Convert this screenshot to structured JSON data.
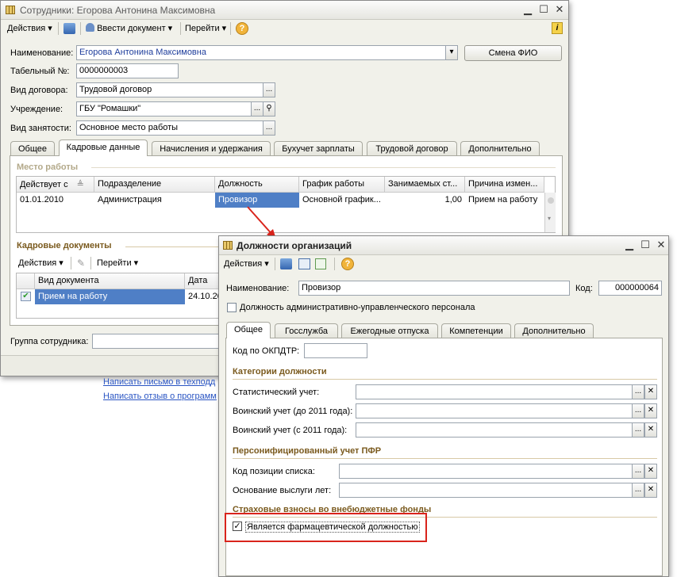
{
  "main_window": {
    "title": "Сотрудники: Егорова Антонина Максимовна",
    "toolbar": {
      "actions": "Действия",
      "enter_document": "Ввести документ",
      "go_to": "Перейти",
      "help_icon": "help-icon"
    },
    "form": {
      "name_label": "Наименование:",
      "name_value": "Егорова Антонина Максимовна",
      "change_name_button": "Смена ФИО",
      "tab_num_label": "Табельный №:",
      "tab_num_value": "0000000003",
      "contract_type_label": "Вид договора:",
      "contract_type_value": "Трудовой договор",
      "institution_label": "Учреждение:",
      "institution_value": "ГБУ \"Ромашки\"",
      "employment_type_label": "Вид занятости:",
      "employment_type_value": "Основное место работы"
    },
    "tabs": [
      "Общее",
      "Кадровые данные",
      "Начисления и удержания",
      "Бухучет зарплаты",
      "Трудовой договор",
      "Дополнительно"
    ],
    "active_tab": 1,
    "workplace": {
      "section_title": "Место работы",
      "columns": [
        "Действует с",
        "Подразделение",
        "Должность",
        "График работы",
        "Занимаемых ст...",
        "Причина измен..."
      ],
      "rows": [
        [
          "01.01.2010",
          "Администрация",
          "Провизор",
          "Основной график...",
          "1,00",
          "Прием на работу"
        ]
      ]
    },
    "hr_docs": {
      "section_title": "Кадровые документы",
      "actions": "Действия",
      "go_to": "Перейти",
      "columns": [
        "Вид документа",
        "Дата"
      ],
      "rows": [
        [
          "Прием на работу",
          "24.10.20"
        ]
      ]
    },
    "group_label": "Группа сотрудника:",
    "links": [
      "Написать письмо в техподд",
      "Написать отзыв о программ"
    ]
  },
  "dialog": {
    "title": "Должности организаций",
    "toolbar": {
      "actions": "Действия"
    },
    "name_label": "Наименование:",
    "name_value": "Провизор",
    "code_label": "Код:",
    "code_value": "000000064",
    "admin_staff_checkbox": "Должность административно-управленческого персонала",
    "tabs": [
      "Общее",
      "Госслужба",
      "Ежегодные отпуска",
      "Компетенции",
      "Дополнительно"
    ],
    "active_tab": 0,
    "okpdtr_label": "Код по ОКПДТР:",
    "categories": {
      "title": "Категории должности",
      "stat_label": "Статистический учет:",
      "military_before_label": "Воинский учет (до 2011 года):",
      "military_after_label": "Воинский учет (с 2011 года):"
    },
    "pfr": {
      "title": "Персонифицированный учет ПФР",
      "list_position_label": "Код позиции списка:",
      "seniority_label": "Основание выслуги лет:"
    },
    "insurance": {
      "title": "Страховые взносы во внебюджетные фонды",
      "pharma_checkbox": "Является фармацевтической должностью",
      "pharma_checked": true
    }
  },
  "colors": {
    "selection": "#4f7fc6",
    "highlight_box": "#d9241c",
    "arrow": "#d9241c"
  }
}
